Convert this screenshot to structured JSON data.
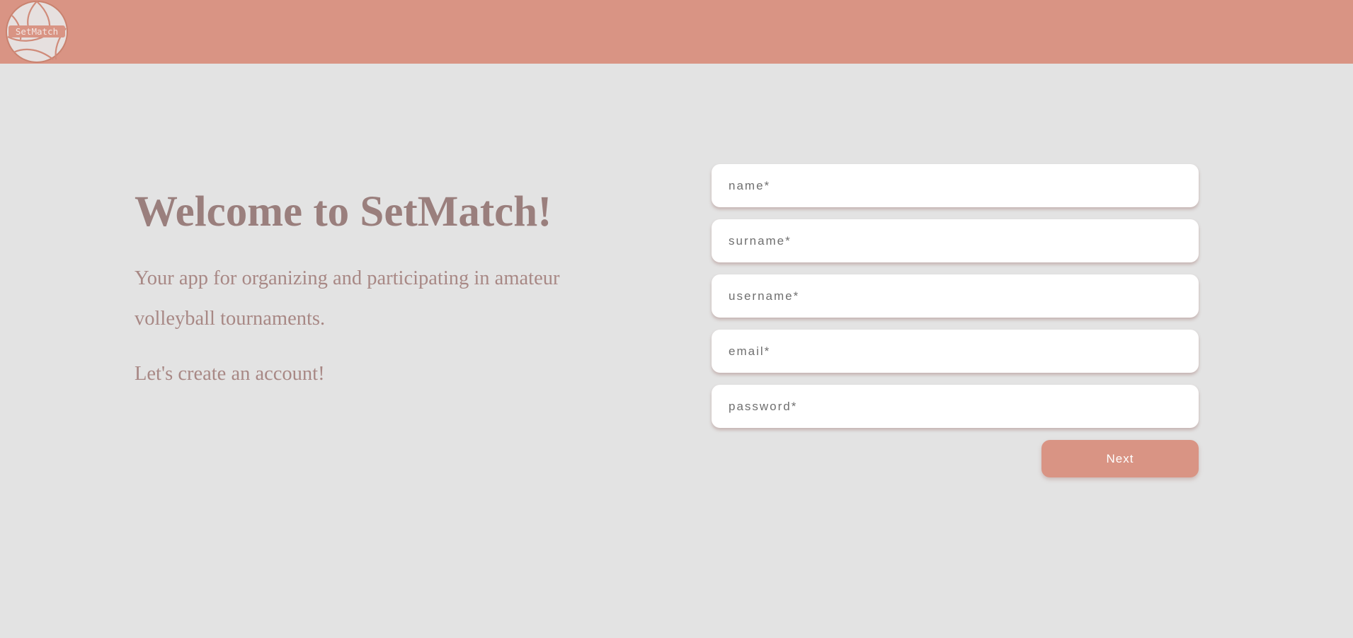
{
  "header": {
    "logo": {
      "icon": "volleyball-logo-icon",
      "text": "SetMatch"
    }
  },
  "intro": {
    "title": "Welcome to SetMatch!",
    "tagline": "Your app for organizing and participating in amateur volleyball tournaments.",
    "cta": "Let's create an account!"
  },
  "form": {
    "fields": [
      {
        "name": "name",
        "placeholder": "name*",
        "value": ""
      },
      {
        "name": "surname",
        "placeholder": "surname*",
        "value": ""
      },
      {
        "name": "username",
        "placeholder": "username*",
        "value": ""
      },
      {
        "name": "email",
        "placeholder": "email*",
        "value": ""
      },
      {
        "name": "password",
        "placeholder": "password*",
        "value": ""
      }
    ],
    "next_label": "Next"
  },
  "colors": {
    "accent": "#d99484",
    "background": "#e3e3e3",
    "heading": "#9a7f7d",
    "field_background": "#ffffff"
  }
}
